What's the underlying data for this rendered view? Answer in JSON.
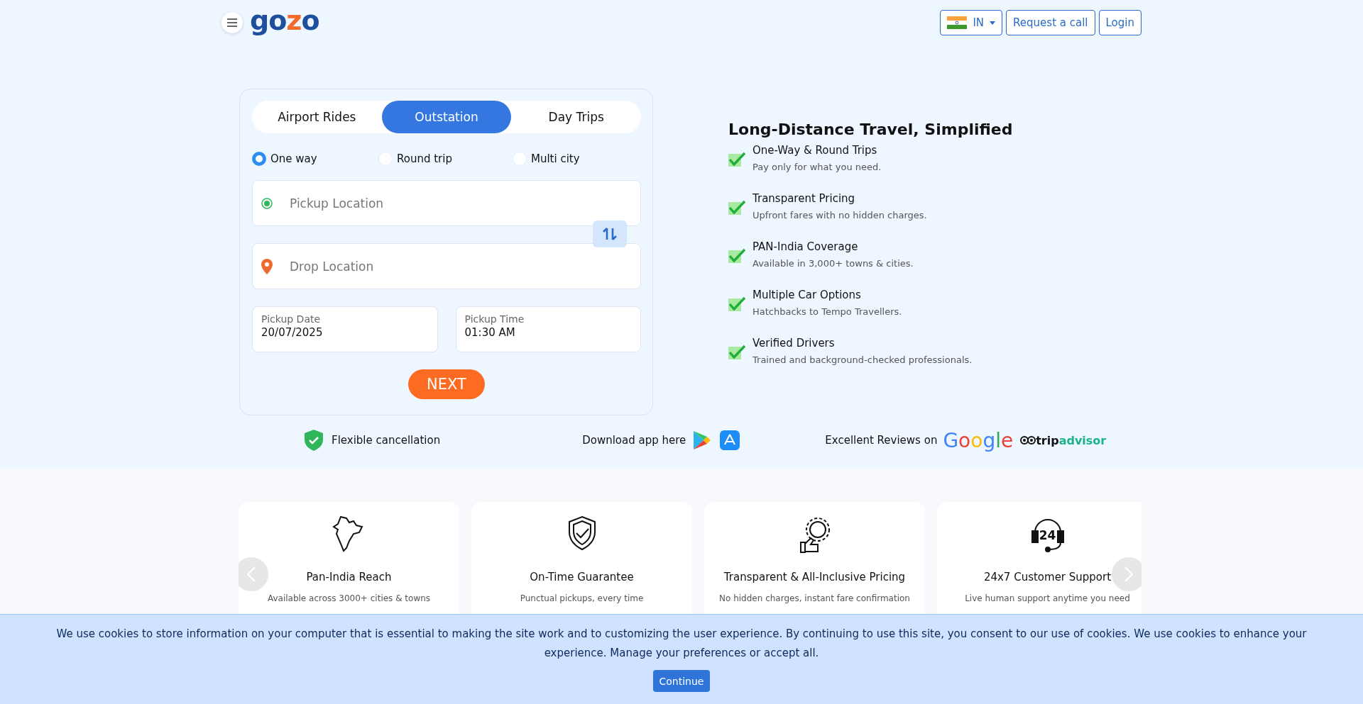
{
  "header": {
    "logo": "gozo",
    "country": "IN",
    "buttons": [
      "Request a call",
      "Login"
    ]
  },
  "booking": {
    "tabs": [
      {
        "label": "Airport Rides",
        "selected": false
      },
      {
        "label": "Outstation",
        "selected": true
      },
      {
        "label": "Day Trips",
        "selected": false
      }
    ],
    "trip_types": [
      {
        "label": "One way",
        "selected": true
      },
      {
        "label": "Round trip",
        "selected": false
      },
      {
        "label": "Multi city",
        "selected": false
      }
    ],
    "pickup": {
      "placeholder": "Pickup Location"
    },
    "drop": {
      "placeholder": "Drop Location"
    },
    "date": {
      "label": "Pickup Date",
      "value": "20/07/2025"
    },
    "time": {
      "label": "Pickup Time",
      "value": "01:30 AM"
    },
    "submit": "NEXT"
  },
  "benefits": {
    "title": "Long-Distance Travel, Simplified",
    "items": [
      {
        "title": "One-Way & Round Trips",
        "text": "Pay only for what you need."
      },
      {
        "title": "Transparent Pricing",
        "text": "Upfront fares with no hidden charges."
      },
      {
        "title": "PAN-India Coverage",
        "text": "Available in 3,000+ towns & cities."
      },
      {
        "title": "Multiple Car Options",
        "text": "Hatchbacks to Tempo Travellers."
      },
      {
        "title": "Verified Drivers",
        "text": "Trained and background-checked professionals."
      }
    ]
  },
  "trust_bar": {
    "cancellation": "Flexible cancellation",
    "download": "Download app here",
    "reviews": "Excellent Reviews on",
    "google": "Google",
    "tripadvisor": [
      "trip",
      "advisor"
    ]
  },
  "features": [
    {
      "kind": "map",
      "title": "Pan-India Reach",
      "text": "Available across 3000+ cities & towns"
    },
    {
      "kind": "shield",
      "title": "On-Time Guarantee",
      "text": "Punctual pickups, every time"
    },
    {
      "kind": "price",
      "title": "Transparent & All-Inclusive Pricing",
      "text": "No hidden charges, instant fare confirmation"
    },
    {
      "kind": "support",
      "title": "24x7 Customer Support",
      "text": "Live human support anytime you need",
      "badge": "24"
    }
  ],
  "cookie_banner": {
    "text": "We use cookies to store information on your computer that is essential to making the site work and to customizing the user experience. By continuing to use this site, you consent to our use of cookies. We use cookies to enhance your experience. Manage your preferences or accept all.",
    "button": "Continue"
  }
}
